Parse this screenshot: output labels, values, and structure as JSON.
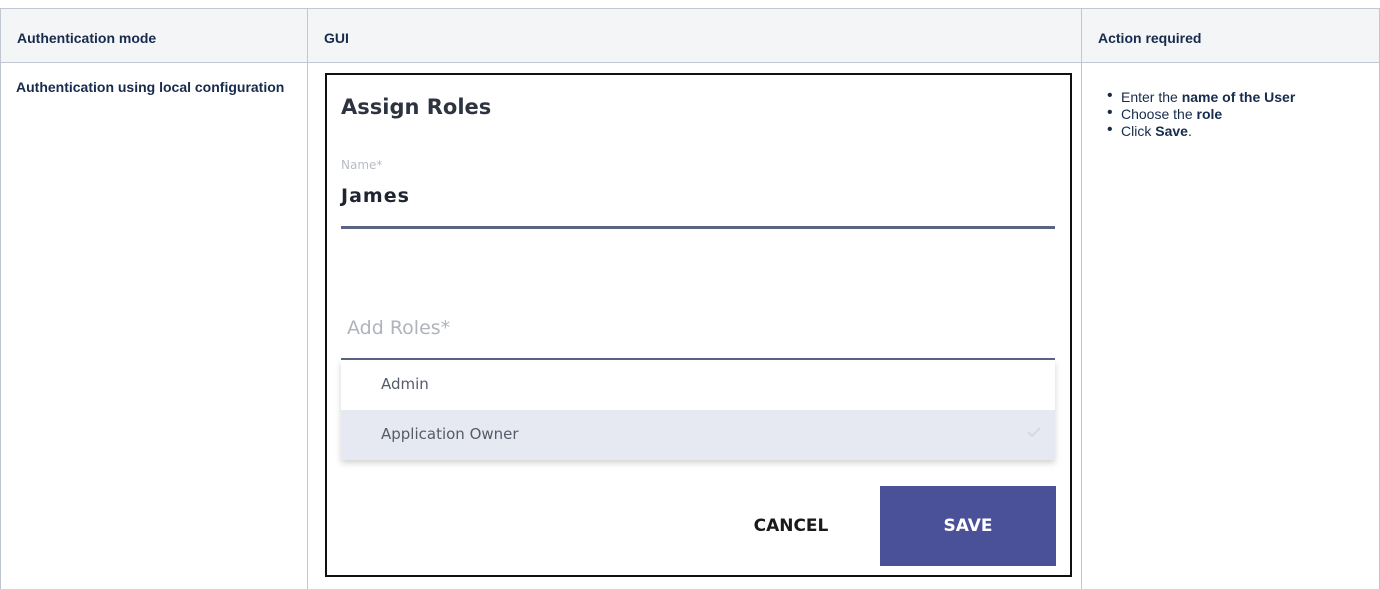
{
  "table": {
    "headers": [
      "Authentication mode",
      "GUI",
      "Action required"
    ],
    "row": {
      "mode": "Authentication using local configuration"
    }
  },
  "gui": {
    "title": "Assign Roles",
    "name_label": "Name*",
    "name_value": "James",
    "roles_label": "Add Roles*",
    "options": [
      {
        "label": "Admin",
        "selected": false
      },
      {
        "label": "Application Owner",
        "selected": true
      }
    ],
    "check_icon": "check-icon",
    "cancel_label": "CANCEL",
    "save_label": "SAVE",
    "colors": {
      "save_bg": "#4a5199",
      "selected_bg": "#e7e9f2",
      "underline": "#5a6484"
    }
  },
  "actions": {
    "item1": {
      "prefix": "Enter the ",
      "bold": "name of the User"
    },
    "item2": {
      "prefix": "Choose the ",
      "bold": "role"
    },
    "item3": {
      "prefix": "Click ",
      "bold": "Save",
      "suffix": "."
    }
  }
}
